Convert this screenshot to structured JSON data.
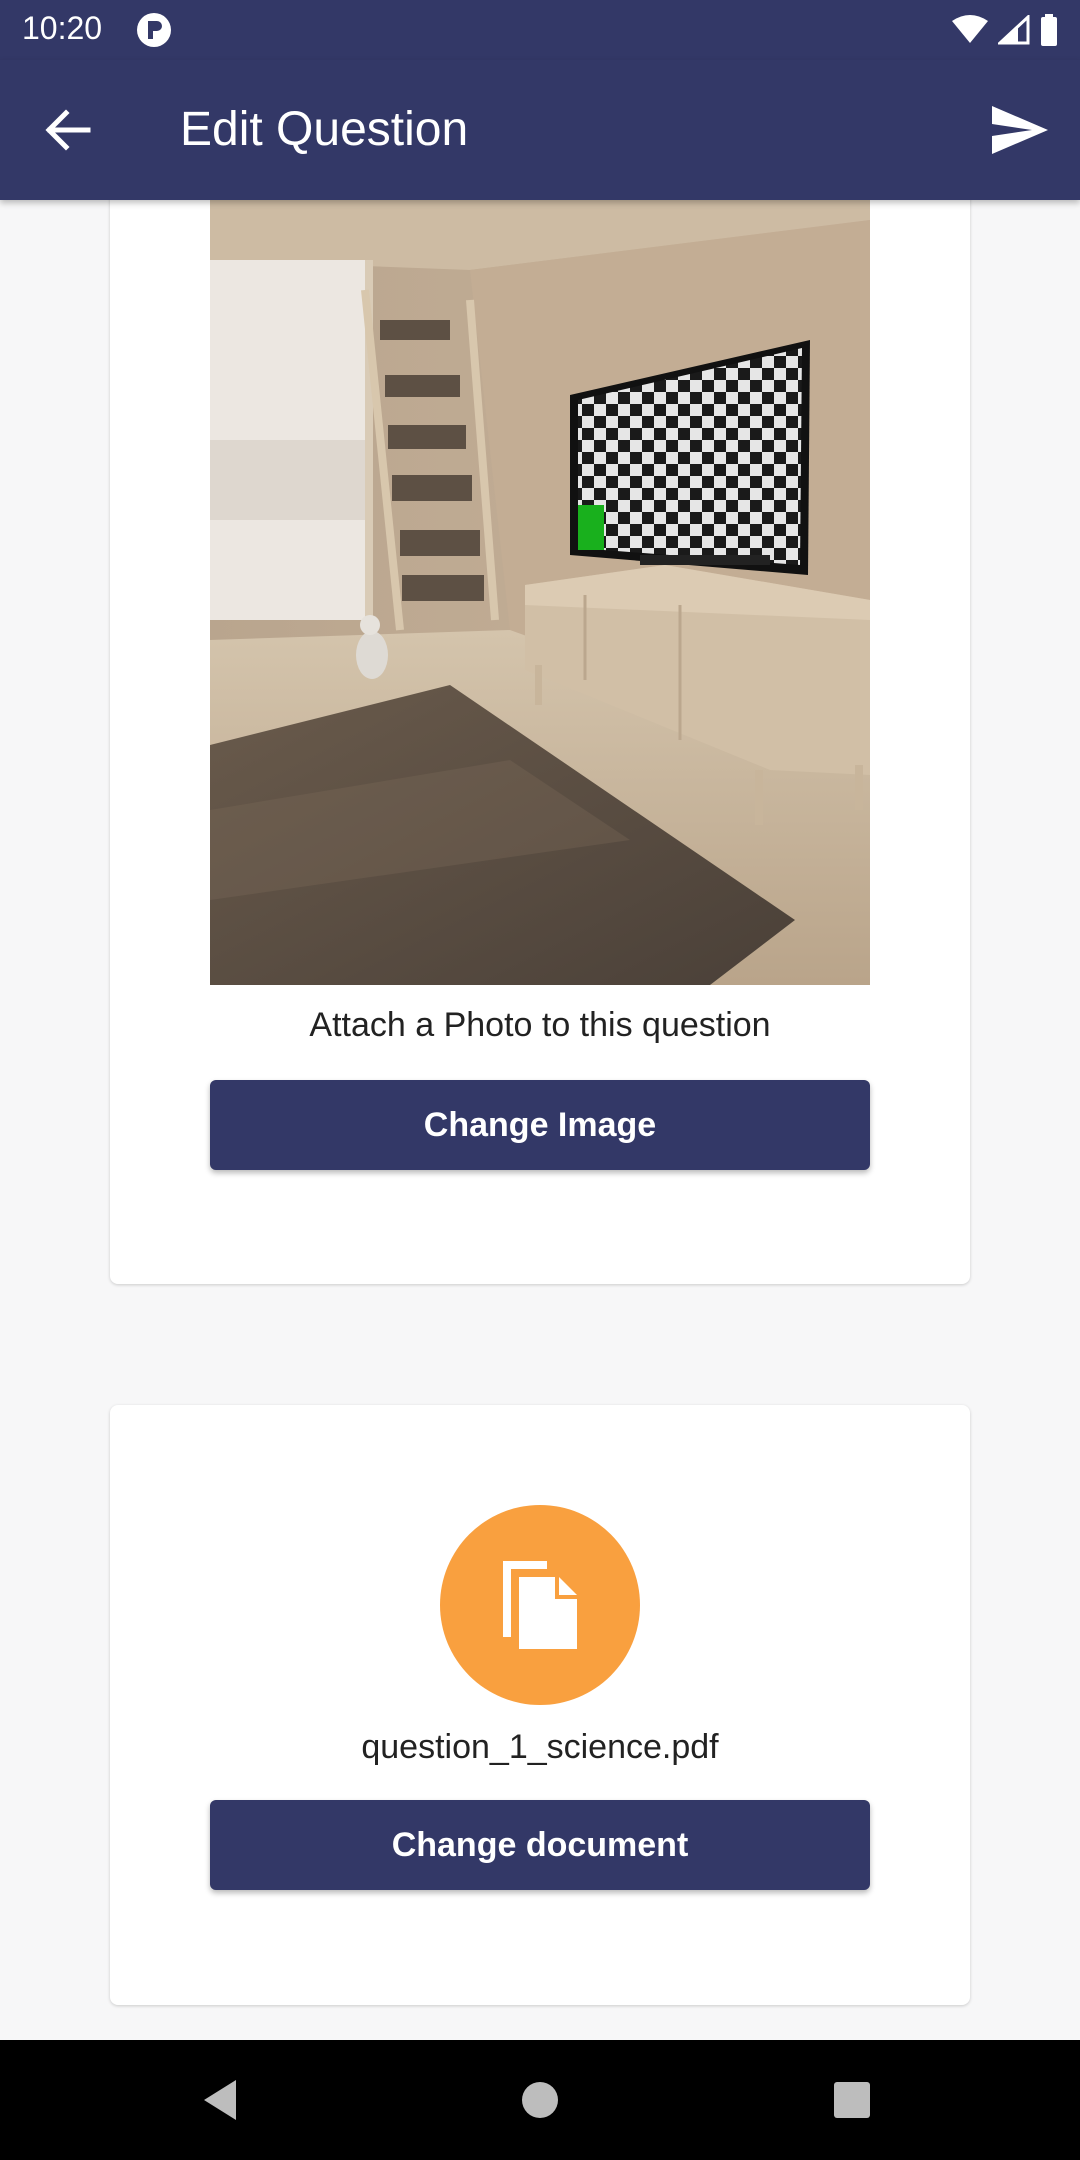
{
  "status_bar": {
    "time": "10:20",
    "icons": [
      "app-notification-icon",
      "wifi-icon",
      "signal-icon",
      "battery-icon"
    ]
  },
  "app_bar": {
    "title": "Edit Question",
    "back_icon": "arrow-back-icon",
    "send_icon": "send-icon"
  },
  "image_card": {
    "photo_description_icon": "room-photo",
    "caption": "Attach a Photo to this question",
    "button_label": "Change Image"
  },
  "document_card": {
    "icon": "file-copy-icon",
    "file_name": "question_1_science.pdf",
    "button_label": "Change document"
  },
  "colors": {
    "primary": "#333867",
    "accent": "#F9A03F",
    "background": "#F7F7F8"
  },
  "nav_bar": {
    "icons": [
      "nav-back-icon",
      "nav-home-icon",
      "nav-recents-icon"
    ]
  }
}
